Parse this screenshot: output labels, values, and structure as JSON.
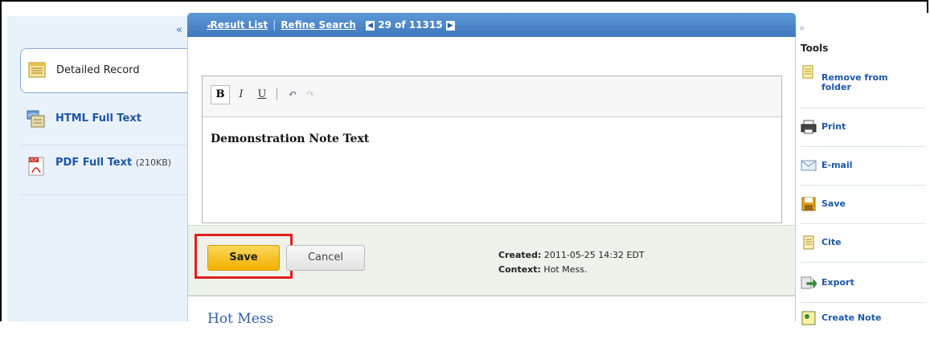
{
  "nav": {
    "result_list": "Result List",
    "refine_search": "Refine Search",
    "counter": "29 of 11315"
  },
  "left_panel": {
    "collapse_glyph": "«",
    "items": [
      {
        "label": "Detailed Record",
        "icon": "detailed-record-icon"
      },
      {
        "label": "HTML Full Text",
        "icon": "html-full-text-icon"
      },
      {
        "label": "PDF Full Text",
        "size": "(210KB)",
        "icon": "pdf-icon"
      }
    ]
  },
  "editor": {
    "toolbar": {
      "bold": "B",
      "italic": "I",
      "underline": "U",
      "undo": "↶",
      "redo": "↷"
    },
    "content": "Demonstration Note Text"
  },
  "actions": {
    "save_label": "Save",
    "cancel_label": "Cancel"
  },
  "meta": {
    "created_label": "Created:",
    "created_value": " 2011-05-25 14:32 EDT",
    "context_label": "Context:",
    "context_value": " Hot Mess."
  },
  "article": {
    "title": "Hot Mess"
  },
  "tools": {
    "collapse_glyph": "»",
    "header": "Tools",
    "items": [
      {
        "label": "Remove from folder",
        "icon": "folder-icon"
      },
      {
        "label": "Print",
        "icon": "print-icon"
      },
      {
        "label": "E-mail",
        "icon": "email-icon"
      },
      {
        "label": "Save",
        "icon": "save-icon"
      },
      {
        "label": "Cite",
        "icon": "cite-icon"
      },
      {
        "label": "Export",
        "icon": "export-icon"
      },
      {
        "label": "Create Note",
        "icon": "create-note-icon"
      }
    ]
  },
  "colors": {
    "header_blue": "#4a86c8",
    "link_blue": "#1d56a8",
    "save_yellow": "#f5c12e",
    "highlight_red": "#e0201b",
    "footer_bg": "#eef2ea",
    "left_bg": "#e9f1fb"
  }
}
